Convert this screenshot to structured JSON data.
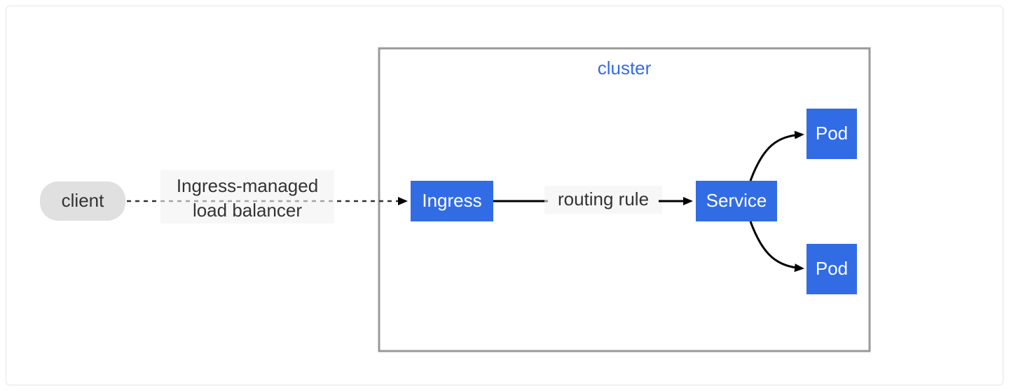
{
  "diagram": {
    "cluster": {
      "title": "cluster"
    },
    "nodes": {
      "client": {
        "label": "client"
      },
      "ingress": {
        "label": "Ingress"
      },
      "service": {
        "label": "Service"
      },
      "pod1": {
        "label": "Pod"
      },
      "pod2": {
        "label": "Pod"
      }
    },
    "edges": {
      "clientToIngress": {
        "label_line1": "Ingress-managed",
        "label_line2": "load balancer"
      },
      "ingressToService": {
        "label": "routing rule"
      }
    },
    "colors": {
      "accent": "#326CE5",
      "clientFill": "#e0e0e0",
      "clusterBorder": "#999999",
      "edgeLabelBg": "#f2f2f2",
      "textDark": "#333333",
      "textLight": "#ffffff",
      "arrowStroke": "#000000"
    }
  }
}
